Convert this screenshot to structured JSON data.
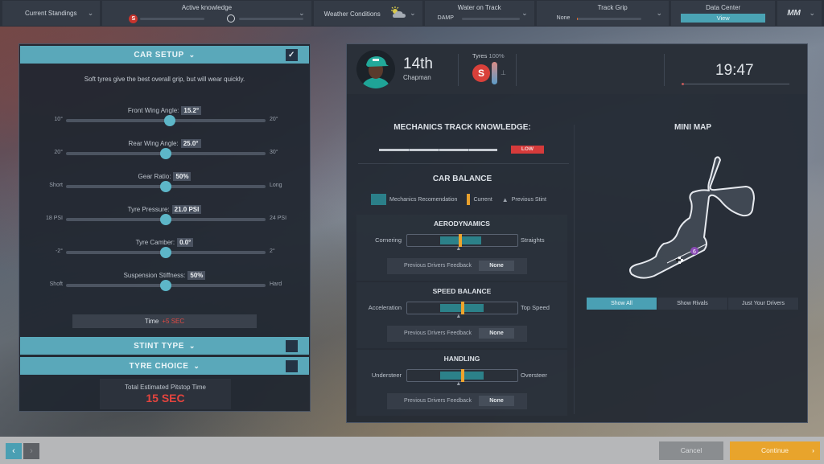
{
  "topbar": {
    "standings": {
      "label": "Current Standings"
    },
    "active_knowledge": {
      "label": "Active knowledge",
      "tyre_icon": "S",
      "tyre_progress": 0,
      "time_progress": 0
    },
    "weather": {
      "label": "Weather Conditions",
      "icon": "partly-cloudy-icon"
    },
    "water": {
      "label": "Water on Track",
      "value": "DAMP",
      "progress": 0
    },
    "grip": {
      "label": "Track Grip",
      "value": "None",
      "progress": 0.02
    },
    "data_center": {
      "label": "Data Center",
      "button": "View"
    },
    "logo": "MM"
  },
  "car_setup": {
    "title": "CAR SETUP",
    "checked": "✓",
    "hint": "Soft tyres give the best overall grip, but will wear quickly.",
    "sliders": [
      {
        "label": "Front Wing Angle:",
        "value": "15.2°",
        "min": "10°",
        "max": "20°",
        "position": 0.52
      },
      {
        "label": "Rear Wing Angle:",
        "value": "25.0°",
        "min": "20°",
        "max": "30°",
        "position": 0.5
      },
      {
        "label": "Gear Ratio:",
        "value": "50%",
        "min": "Short",
        "max": "Long",
        "position": 0.5
      },
      {
        "label": "Tyre Pressure:",
        "value": "21.0 PSI",
        "min": "18 PSI",
        "max": "24 PSI",
        "position": 0.5
      },
      {
        "label": "Tyre Camber:",
        "value": "0.0°",
        "min": "-2°",
        "max": "2°",
        "position": 0.5
      },
      {
        "label": "Suspension Stiffness:",
        "value": "50%",
        "min": "Shoft",
        "max": "Hard",
        "position": 0.5
      }
    ],
    "time_label": "Time",
    "time_value": "+5 SEC"
  },
  "stint_type": {
    "title": "STINT TYPE"
  },
  "tyre_choice": {
    "title": "TYRE CHOICE"
  },
  "pitstop": {
    "label": "Total Estimated Pitstop Time",
    "value": "15 SEC"
  },
  "driver": {
    "position": "14th",
    "name": "Chapman",
    "tyres_label": "Tyres",
    "tyres_value": "100%",
    "tyre_compound": "S"
  },
  "session": {
    "clock": "19:47"
  },
  "mechanics": {
    "title": "MECHANICS TRACK KNOWLEDGE:",
    "level": "LOW"
  },
  "car_balance": {
    "title": "CAR BALANCE",
    "legend": {
      "reco": "Mechanics Recomendation",
      "current": "Current",
      "previous": "Previous Stint"
    },
    "sections": [
      {
        "title": "AERODYNAMICS",
        "left": "Cornering",
        "right": "Straights",
        "reco_from": 0.3,
        "reco_to": 0.67,
        "current": 0.48,
        "previous": 0.47,
        "feedback_label": "Previous Drivers Feedback",
        "feedback": "None"
      },
      {
        "title": "SPEED BALANCE",
        "left": "Acceleration",
        "right": "Top Speed",
        "reco_from": 0.3,
        "reco_to": 0.69,
        "current": 0.5,
        "previous": 0.47,
        "feedback_label": "Previous Drivers Feedback",
        "feedback": "None"
      },
      {
        "title": "HANDLING",
        "left": "Understeer",
        "right": "Oversteer",
        "reco_from": 0.3,
        "reco_to": 0.69,
        "current": 0.5,
        "previous": 0.47,
        "feedback_label": "Previous Drivers Feedback",
        "feedback": "None"
      }
    ]
  },
  "mini_map": {
    "title": "MINI MAP",
    "car_number": "6",
    "tabs": [
      {
        "label": "Show All",
        "active": true
      },
      {
        "label": "Show Rivals",
        "active": false
      },
      {
        "label": "Just Your Drivers",
        "active": false
      }
    ]
  },
  "footer": {
    "back": "‹",
    "forward": "›",
    "cancel": "Cancel",
    "continue": "Continue",
    "continue_arrow": "›"
  }
}
